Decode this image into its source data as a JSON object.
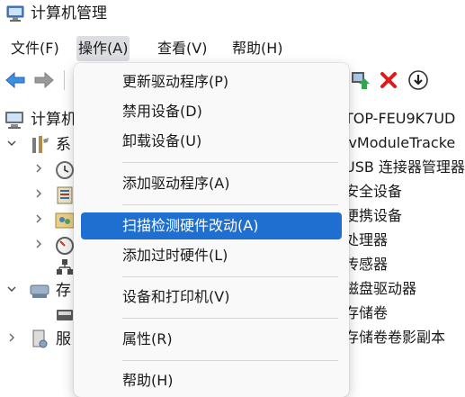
{
  "window": {
    "title": "计算机管理",
    "app_icon": "computer-management-icon"
  },
  "menubar": {
    "items": [
      {
        "label": "文件(F)"
      },
      {
        "label": "操作(A)",
        "active": true
      },
      {
        "label": "查看(V)"
      },
      {
        "label": "帮助(H)"
      }
    ]
  },
  "toolbar": {
    "buttons": [
      "back-arrow-icon",
      "forward-arrow-icon",
      "enable-device-icon",
      "delete-icon",
      "down-arrow-icon"
    ]
  },
  "tree": {
    "items": [
      {
        "label": "计算机",
        "icon": "computer-icon"
      },
      {
        "label": "系",
        "icon": "tools-icon",
        "expanded": true
      },
      {
        "label": "",
        "icon": "clock-icon"
      },
      {
        "label": "",
        "icon": "viewer-icon"
      },
      {
        "label": "",
        "icon": "users-icon"
      },
      {
        "label": "",
        "icon": "gauge-icon"
      },
      {
        "label": "",
        "icon": "device-manager-icon"
      },
      {
        "label": "存",
        "icon": "storage-icon",
        "expanded": true
      },
      {
        "label": "",
        "icon": "disk-icon"
      },
      {
        "label": "服",
        "icon": "services-icon"
      }
    ]
  },
  "right_panel": {
    "items": [
      "TOP-FEU9K7UD",
      "lvModuleTracke",
      "USB 连接器管理器",
      "安全设备",
      "便携设备",
      "处理器",
      "传感器",
      "磁盘驱动器",
      "存储卷",
      "存储卷卷影副本"
    ]
  },
  "dropdown": {
    "items": [
      {
        "label": "更新驱动程序(P)"
      },
      {
        "label": "禁用设备(D)"
      },
      {
        "label": "卸载设备(U)"
      },
      {
        "label": "添加驱动程序(A)"
      },
      {
        "label": "扫描检测硬件改动(A)",
        "highlighted": true
      },
      {
        "label": "添加过时硬件(L)"
      },
      {
        "label": "设备和打印机(V)"
      },
      {
        "label": "属性(R)"
      },
      {
        "label": "帮助(H)"
      }
    ]
  },
  "colors": {
    "highlight": "#1f6fd0",
    "delete_red": "#e0191d",
    "menu_active": "#dcdde1"
  }
}
